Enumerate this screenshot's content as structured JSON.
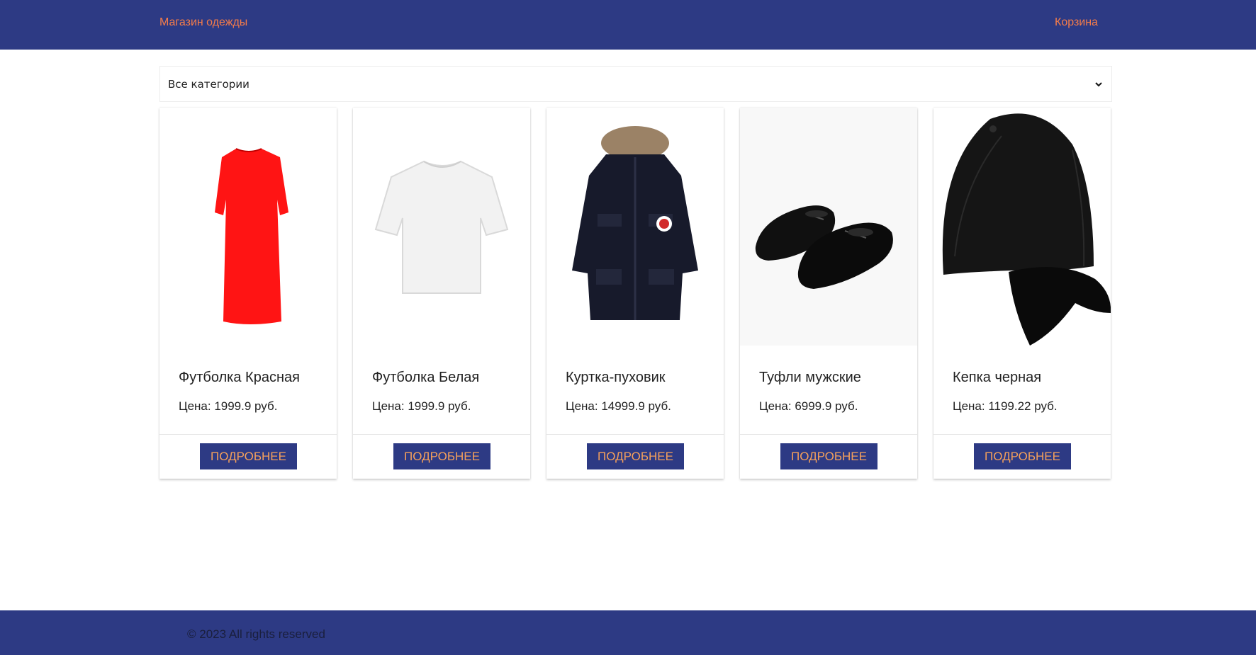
{
  "header": {
    "brand": "Магазин одежды",
    "cart": "Корзина"
  },
  "filter": {
    "selected": "Все категории"
  },
  "products": [
    {
      "title": "Футболка Красная",
      "price": "Цена: 1999.9 руб.",
      "button": "Подробнее",
      "image": "red-dress-image"
    },
    {
      "title": "Футболка Белая",
      "price": "Цена: 1999.9 руб.",
      "button": "Подробнее",
      "image": "white-tshirt-image"
    },
    {
      "title": "Куртка-пуховик",
      "price": "Цена: 14999.9 руб.",
      "button": "Подробнее",
      "image": "down-jacket-image"
    },
    {
      "title": "Туфли мужские",
      "price": "Цена: 6999.9 руб.",
      "button": "Подробнее",
      "image": "mens-shoes-image"
    },
    {
      "title": "Кепка черная",
      "price": "Цена: 1199.22 руб.",
      "button": "Подробнее",
      "image": "black-cap-image"
    }
  ],
  "footer": {
    "copyright": "© 2023 All rights reserved"
  },
  "colors": {
    "nav": "#2d3a84",
    "accent": "#f47c4a",
    "button_text": "#f4a05b"
  }
}
